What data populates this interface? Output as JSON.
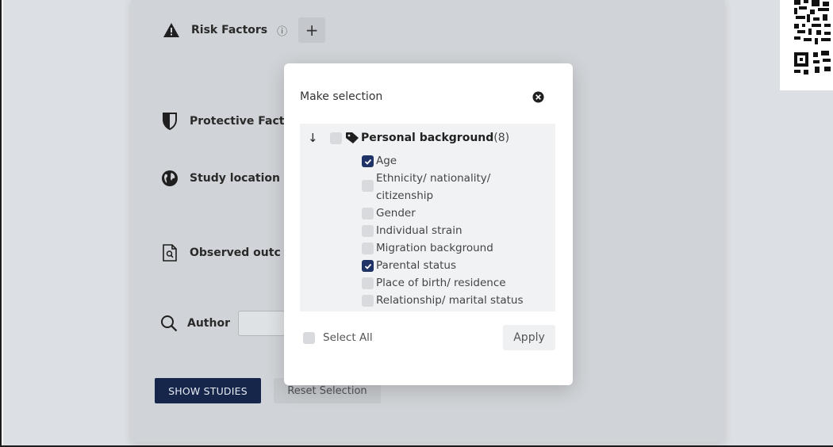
{
  "filters": {
    "risk_factors": "Risk Factors",
    "protective_factors": "Protective Fact",
    "study_location": "Study location",
    "observed_outcomes": "Observed outc",
    "author": "Author",
    "plus": "+",
    "info": "ⓘ"
  },
  "actions": {
    "show_studies": "SHOW STUDIES",
    "reset_selection": "Reset Selection"
  },
  "modal": {
    "title": "Make selection",
    "group": {
      "arrow": "↓",
      "label": "Personal background",
      "count": "(8)"
    },
    "items": [
      {
        "label": "Age",
        "checked": true
      },
      {
        "label": "Ethnicity/ nationality/ citizenship",
        "checked": false
      },
      {
        "label": "Gender",
        "checked": false
      },
      {
        "label": "Individual strain",
        "checked": false
      },
      {
        "label": "Migration background",
        "checked": false
      },
      {
        "label": "Parental status",
        "checked": true
      },
      {
        "label": "Place of birth/ residence",
        "checked": false
      },
      {
        "label": "Relationship/ marital status",
        "checked": false
      }
    ],
    "select_all": "Select All",
    "apply": "Apply"
  },
  "colors": {
    "primary": "#16254a",
    "checkbox_checked": "#1f3366",
    "overlay_panel": "#d0d3d7"
  },
  "icons": {
    "risk": "warning-triangle-icon",
    "protective": "shield-icon",
    "location": "globe-icon",
    "outcome": "document-search-icon",
    "author": "search-icon",
    "close": "close-circle-icon",
    "tag": "tag-icon"
  }
}
